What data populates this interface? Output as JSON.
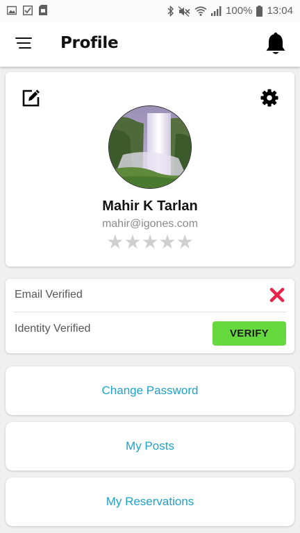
{
  "status_bar": {
    "battery_percent": "100%",
    "time": "13:04",
    "left_icons": [
      "image-icon",
      "checkbox-icon",
      "sd-card-icon"
    ],
    "right_icons": [
      "bluetooth-icon",
      "mute-icon",
      "wifi-icon",
      "signal-icon",
      "battery-icon"
    ]
  },
  "app_bar": {
    "title": "Profile",
    "menu_icon": "hamburger-menu-icon",
    "notification_icon": "bell-icon"
  },
  "profile": {
    "name": "Mahir K Tarlan",
    "email": "mahir@igones.com",
    "rating": 0,
    "rating_max": 5,
    "stars_text": "★★★★★",
    "edit_icon": "edit-icon",
    "settings_icon": "gear-icon"
  },
  "verification": {
    "email_label": "Email Verified",
    "email_status_icon": "close-x-icon",
    "identity_label": "Identity Verified",
    "verify_button": "VERIFY"
  },
  "links": {
    "change_password": "Change Password",
    "my_posts": "My Posts",
    "my_reservations": "My Reservations"
  },
  "colors": {
    "accent_link": "#1fa2c8",
    "verify_button": "#66d93f",
    "error_x": "#e8234a",
    "star_empty": "#cfcfcf"
  }
}
